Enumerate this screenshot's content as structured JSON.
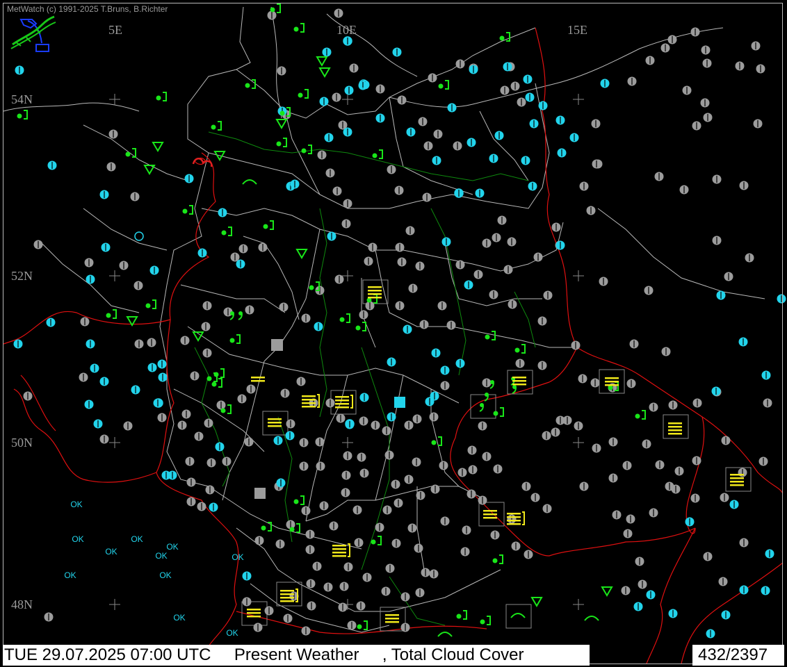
{
  "header": {
    "copyright": "MetWatch  (c) 1991-2025 T.Bruns, B.Richter"
  },
  "grid_labels": {
    "lon": [
      "5E",
      "10E",
      "15E"
    ],
    "lat": [
      "54N",
      "52N",
      "50N",
      "48N"
    ]
  },
  "ok_label": "OK",
  "status_bar": {
    "datetime": "TUE 29.07.2025 07:00 UTC",
    "product": "Present Weather",
    "product2": ", Total Cloud Cover",
    "station_count": "432/2397"
  },
  "colors": {
    "background": "#000000",
    "border_state": "#b8b8b8",
    "border_country": "#e01010",
    "border_region": "#0e8a0e",
    "station_gray": "#9c9c9c",
    "station_cyan": "#22d4ec",
    "rain_green": "#19e619",
    "fog_yellow": "#f0e81a",
    "thunder_red": "#e02020"
  },
  "legend_icons": [
    "logo-icon",
    "station-cloud-icon",
    "rain-icon",
    "shower-icon",
    "fog-icon",
    "drizzle-icon",
    "thunderstorm-icon"
  ]
}
